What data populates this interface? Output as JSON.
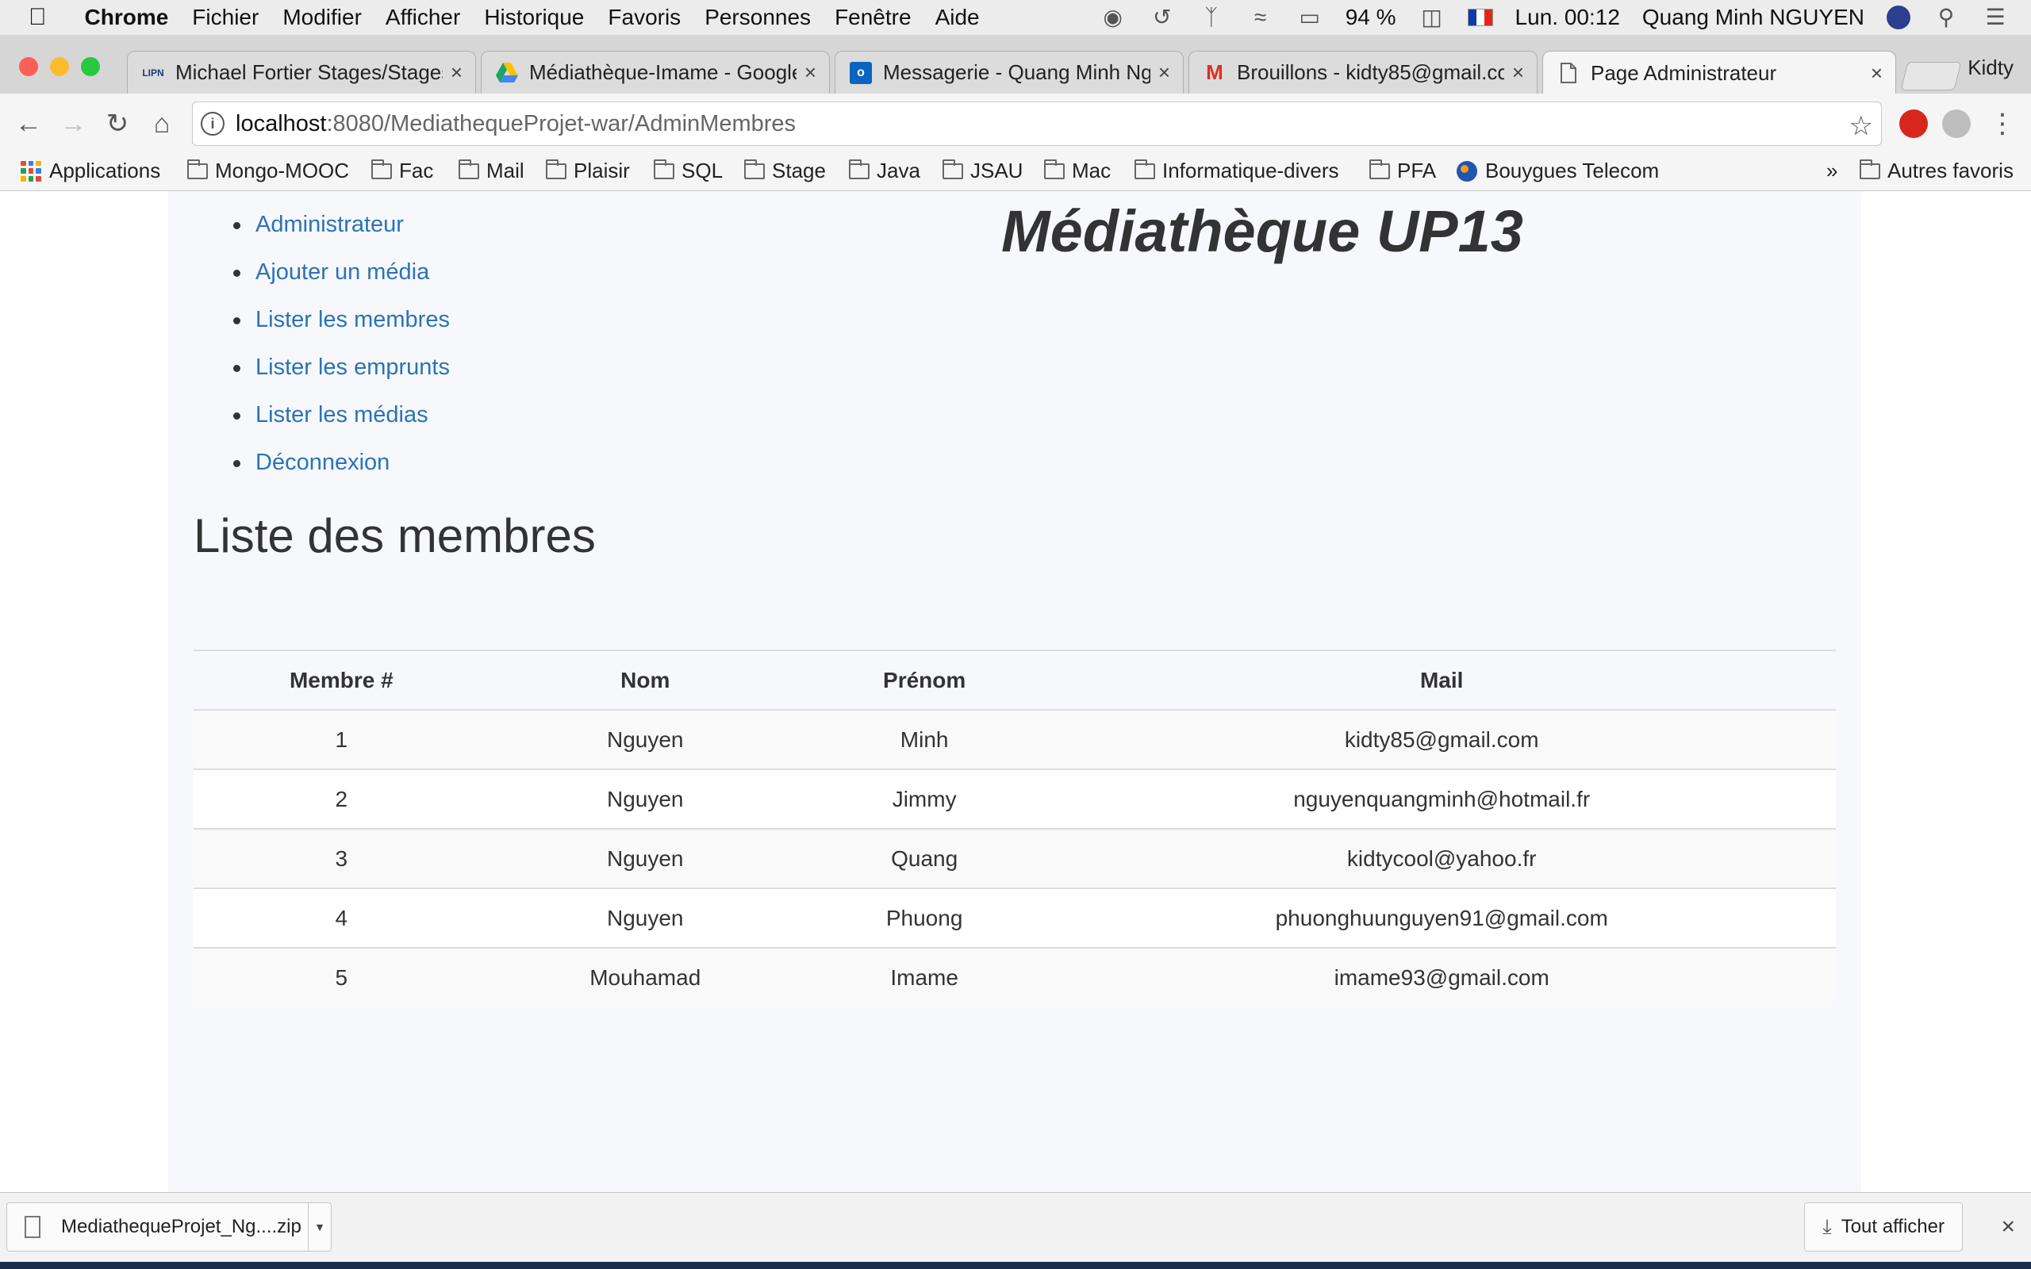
{
  "menubar": {
    "app_name": "Chrome",
    "menus": [
      "Fichier",
      "Modifier",
      "Afficher",
      "Historique",
      "Favoris",
      "Personnes",
      "Fenêtre",
      "Aide"
    ],
    "battery": "94 %",
    "clock": "Lun. 00:12",
    "user": "Quang Minh NGUYEN"
  },
  "tabs": [
    {
      "title": "Michael Fortier Stages/Stages",
      "icon": "lipn-favicon",
      "favicon_text": "LIPN"
    },
    {
      "title": "Médiathèque-Imame - Google",
      "icon": "google-drive-icon"
    },
    {
      "title": "Messagerie - Quang Minh Ngu",
      "icon": "outlook-icon",
      "favicon_text": "o"
    },
    {
      "title": "Brouillons - kidty85@gmail.co",
      "icon": "gmail-icon",
      "favicon_text": "M"
    },
    {
      "title": "Page Administrateur",
      "icon": "page-icon",
      "active": true
    }
  ],
  "profile_name": "Kidty",
  "address": {
    "host": "localhost",
    "path": ":8080/MediathequeProjet-war/AdminMembres"
  },
  "bookmarks": [
    "Applications",
    "Mongo-MOOC",
    "Fac",
    "Mail",
    "Plaisir",
    "SQL",
    "Stage",
    "Java",
    "JSAU",
    "Mac",
    "Informatique-divers",
    "PFA",
    "Bouygues Telecom"
  ],
  "bookmarks_overflow": "»",
  "other_bookmarks": "Autres favoris",
  "page": {
    "site_title": "Médiathèque UP13",
    "nav": [
      "Administrateur",
      "Ajouter un média",
      "Lister les membres",
      "Lister les emprunts",
      "Lister les médias",
      "Déconnexion"
    ],
    "section_title": "Liste des membres",
    "table": {
      "headers": [
        "Membre #",
        "Nom",
        "Prénom",
        "Mail"
      ],
      "rows": [
        [
          "1",
          "Nguyen",
          "Minh",
          "kidty85@gmail.com"
        ],
        [
          "2",
          "Nguyen",
          "Jimmy",
          "nguyenquangminh@hotmail.fr"
        ],
        [
          "3",
          "Nguyen",
          "Quang",
          "kidtycool@yahoo.fr"
        ],
        [
          "4",
          "Nguyen",
          "Phuong",
          "phuonghuunguyen91@gmail.com"
        ],
        [
          "5",
          "Mouhamad",
          "Imame",
          "imame93@gmail.com"
        ]
      ]
    }
  },
  "download_shelf": {
    "file_name": "MediathequeProjet_Ng....zip",
    "show_all": "Tout afficher"
  },
  "colors": {
    "link": "#2a73b7",
    "text": "#333333",
    "container_bg": "#f7f8fc"
  }
}
